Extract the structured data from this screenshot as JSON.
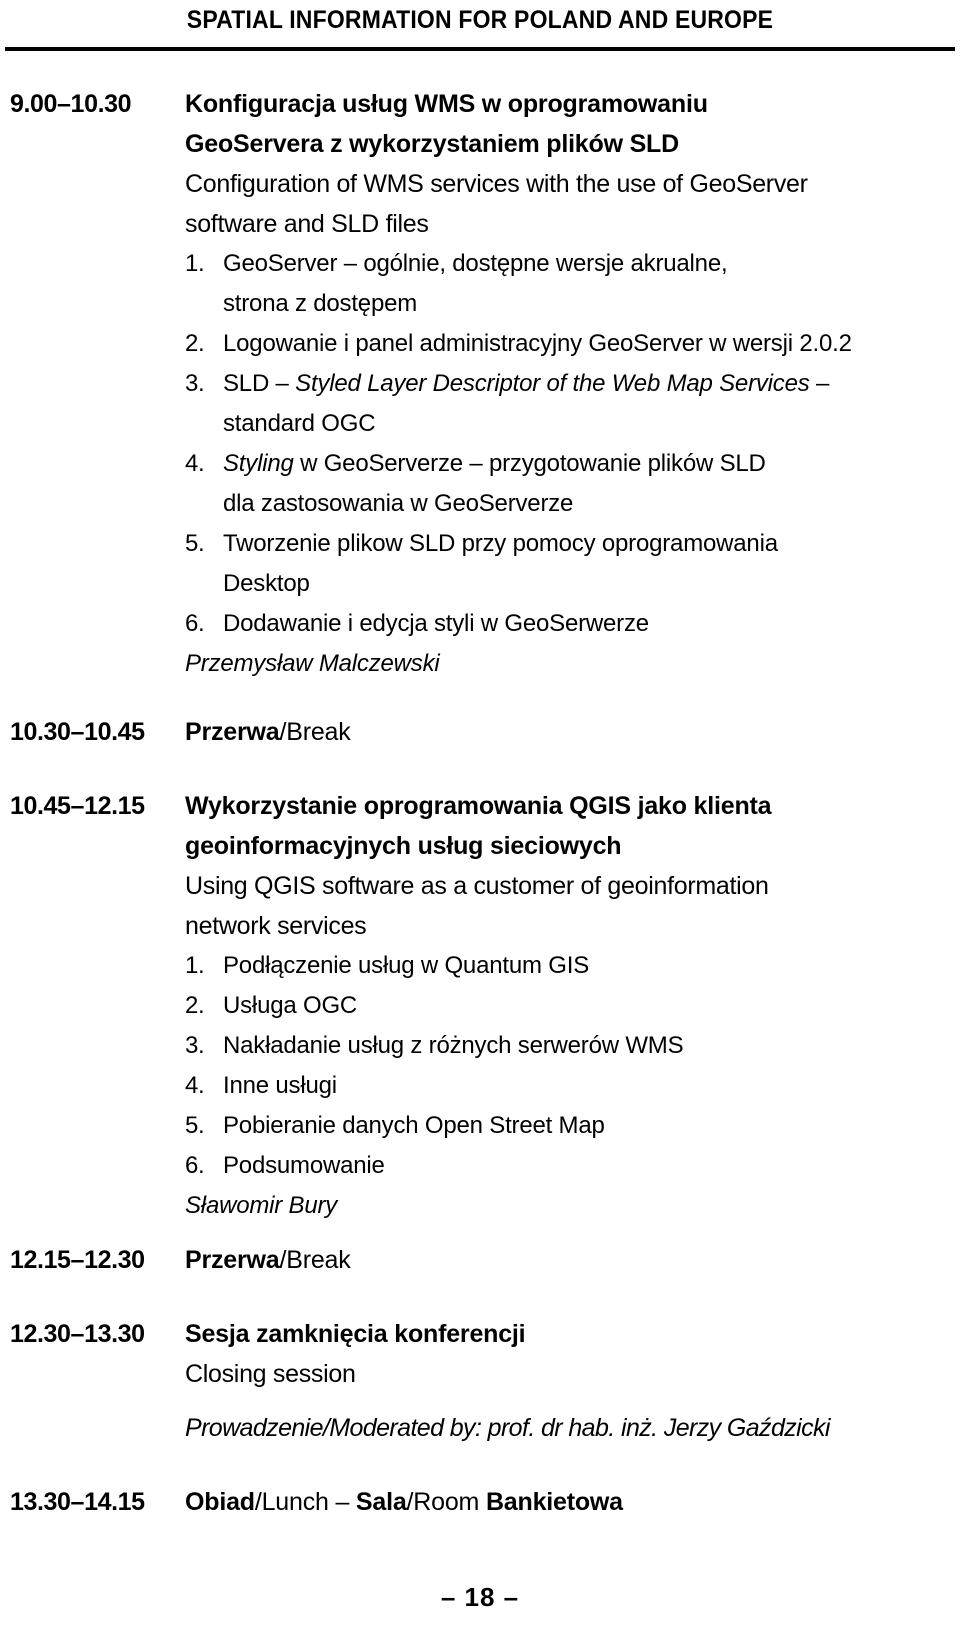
{
  "header": {
    "running_title": "SPATIAL INFORMATION FOR POLAND AND EUROPE"
  },
  "footer": {
    "page_number": "– 18 –"
  },
  "schedule": {
    "entries": [
      {
        "time": "9.00–10.30",
        "title_pl_line1": "Konfiguracja usług WMS w oprogramowaniu",
        "title_pl_line2": "GeoServera z wykorzystaniem plików SLD",
        "title_en_line1": "Configuration of WMS services with the use of  GeoServer",
        "title_en_line2": "software and SLD files",
        "topics": [
          {
            "num": "1.",
            "text_a": "GeoServer – ogólnie, dostępne wersje akrualne,",
            "text_b": "strona z dostępem"
          },
          {
            "num": "2.",
            "text_a": "Logowanie i panel administracyjny GeoServer w wersji 2.0.2"
          },
          {
            "num": "3.",
            "text_pre": "SLD – ",
            "text_italic": "Styled Layer Descriptor of the Web Map Services",
            "text_post": " –",
            "text_b": "standard OGC"
          },
          {
            "num": "4.",
            "text_italic_lead": "Styling",
            "text_a": " w GeoServerze – przygotowanie plików SLD",
            "text_b": "dla zastosowania w GeoServerze"
          },
          {
            "num": "5.",
            "text_a": "Tworzenie plikow SLD przy pomocy oprogramowania",
            "text_b": "Desktop"
          },
          {
            "num": "6.",
            "text_a": "Dodawanie i edycja styli w GeoSerwerze"
          }
        ],
        "speaker": "Przemysław  Malczewski"
      },
      {
        "time": "10.30–10.45",
        "simple_bold": "Przerwa",
        "simple_rest": "/Break"
      },
      {
        "time": "10.45–12.15",
        "title_pl_line1": "Wykorzystanie oprogramowania QGIS jako klienta",
        "title_pl_line2": "geoinformacyjnych usług sieciowych",
        "title_en_line1": "Using QGIS software as a customer of geoinformation",
        "title_en_line2": "network services",
        "topics": [
          {
            "num": "1.",
            "text_a": "Podłączenie usług w Quantum GIS"
          },
          {
            "num": "2.",
            "text_a": "Usługa OGC"
          },
          {
            "num": "3.",
            "text_a": "Nakładanie usług z różnych serwerów WMS"
          },
          {
            "num": "4.",
            "text_a": "Inne usługi"
          },
          {
            "num": "5.",
            "text_a": "Pobieranie danych Open Street Map"
          },
          {
            "num": "6.",
            "text_a": "Podsumowanie"
          }
        ],
        "speaker": "Sławomir Bury"
      },
      {
        "time": "12.15–12.30",
        "simple_bold": "Przerwa",
        "simple_rest": "/Break"
      },
      {
        "time": "12.30–13.30",
        "title_pl_line1": "Sesja zamknięcia konferencji",
        "title_en_line1": "Closing session",
        "moderator": "Prowadzenie/Moderated by: prof. dr hab. inż. Jerzy Gaździcki"
      },
      {
        "time": "13.30–14.15",
        "lunch_bold_1": "Obiad",
        "lunch_rest_1": "/Lunch – ",
        "lunch_bold_2": "Sala",
        "lunch_rest_2": "/Room ",
        "lunch_bold_3": "Bankietowa"
      }
    ]
  }
}
